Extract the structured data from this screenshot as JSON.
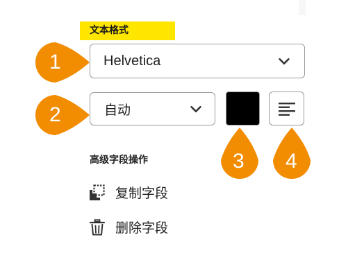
{
  "text_format": {
    "title": "文本格式",
    "font_family": {
      "value": "Helvetica",
      "icon": "chevron-down-icon"
    },
    "font_size": {
      "value": "自动",
      "icon": "chevron-down-icon"
    },
    "font_color": "#000000",
    "alignment_icon": "align-left-icon"
  },
  "advanced": {
    "title": "高级字段操作",
    "copy": {
      "label": "复制字段",
      "icon": "duplicate-icon"
    },
    "delete": {
      "label": "删除字段",
      "icon": "trash-icon"
    }
  },
  "callouts": [
    {
      "number": "1"
    },
    {
      "number": "2"
    },
    {
      "number": "3"
    },
    {
      "number": "4"
    }
  ],
  "colors": {
    "highlight": "#ffe600",
    "callout": "#f28c00",
    "border": "#9a9a9a"
  }
}
